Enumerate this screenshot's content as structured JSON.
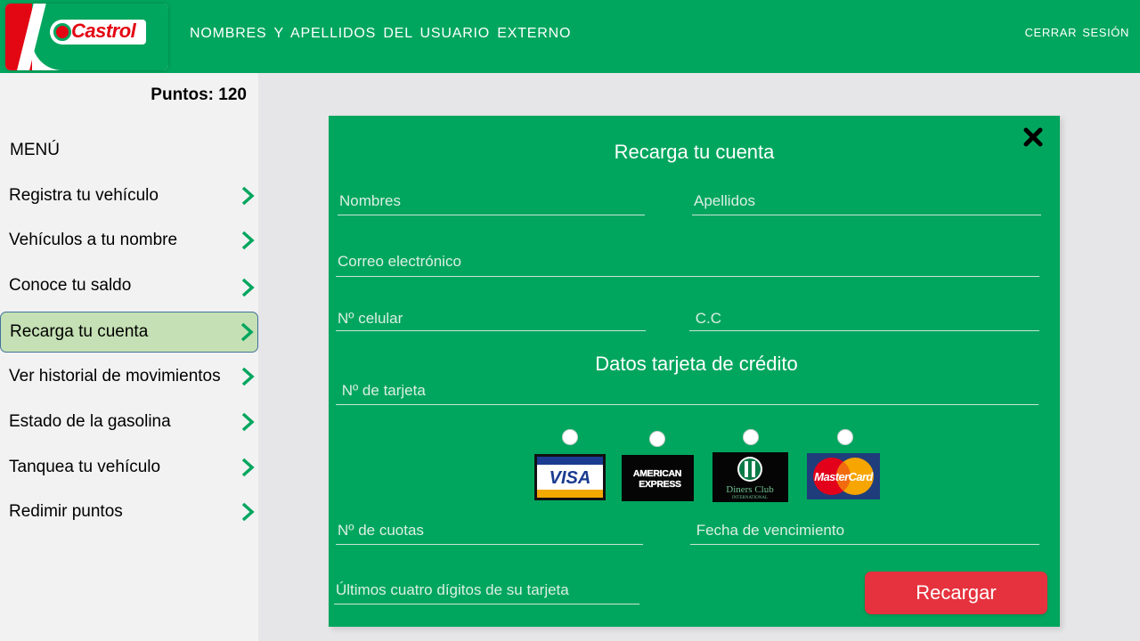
{
  "header": {
    "brand": "Castrol",
    "user_name": "NOMBRES Y APELLIDOS DEL USUARIO EXTERNO",
    "logout_label": "CERRAR SESIÓN"
  },
  "sidebar": {
    "points_label": "Puntos: 120",
    "menu_title": "MENÚ",
    "items": [
      {
        "label": "Registra tu vehículo",
        "active": false
      },
      {
        "label": "Vehículos  a tu nombre",
        "active": false
      },
      {
        "label": "Conoce  tu saldo",
        "active": false
      },
      {
        "label": "Recarga tu cuenta",
        "active": true
      },
      {
        "label": "Ver historial de movimientos",
        "active": false
      },
      {
        "label": "Estado de la gasolina",
        "active": false
      },
      {
        "label": "Tanquea tu vehículo",
        "active": false
      },
      {
        "label": "Redimir puntos",
        "active": false
      }
    ]
  },
  "modal": {
    "title": "Recarga tu cuenta",
    "fields": {
      "nombres": {
        "placeholder": "Nombres",
        "value": ""
      },
      "apellidos": {
        "placeholder": "Apellidos",
        "value": ""
      },
      "correo": {
        "placeholder": "Correo electrónico",
        "value": ""
      },
      "celular": {
        "placeholder": "Nº celular",
        "value": ""
      },
      "cc": {
        "placeholder": " C.C",
        "value": ""
      },
      "tarjeta": {
        "placeholder": " Nº de tarjeta",
        "value": ""
      },
      "cuotas": {
        "placeholder": "Nº de cuotas",
        "value": ""
      },
      "vencimiento": {
        "placeholder": " Fecha de vencimiento",
        "value": ""
      },
      "ultimos": {
        "placeholder": "Últimos cuatro dígitos de su tarjeta",
        "value": ""
      }
    },
    "card_section_title": "Datos tarjeta de crédito",
    "cards": [
      {
        "name": "visa",
        "text": "VISA"
      },
      {
        "name": "american-express",
        "text": "AMERICAN EXPRESS"
      },
      {
        "name": "diners-club",
        "text": "Diners Club",
        "subtext": "INTERNATIONAL"
      },
      {
        "name": "mastercard",
        "text": "MasterCard"
      }
    ],
    "submit_label": "Recargar"
  },
  "colors": {
    "brand_green": "#00a65e",
    "brand_red": "#e30613",
    "button_red": "#e5323e",
    "active_item": "#c5e0b4",
    "chevron_green": "#00a65e"
  }
}
